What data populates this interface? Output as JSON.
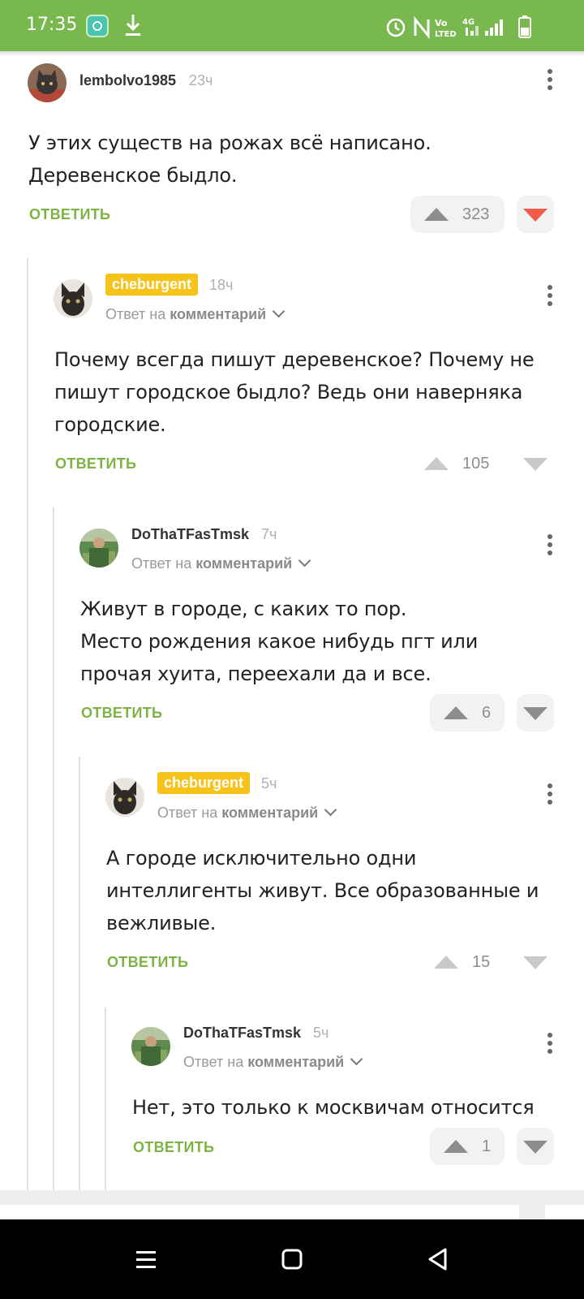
{
  "status_bar": {
    "time": "17:35",
    "icons": [
      "app-update-icon",
      "download-icon",
      "alarm-icon",
      "nfc-icon",
      "volte-icon",
      "4g-signal-icon",
      "signal-icon",
      "battery-icon"
    ]
  },
  "comments": [
    {
      "username": "lembolvo1985",
      "badge": false,
      "time": "23ч",
      "reply_prefix": "",
      "reply_target": "",
      "text": [
        "У этих существ на рожах всё написано.",
        "Деревенское быдло."
      ],
      "reply_label": "ОТВЕТИТЬ",
      "score": "323",
      "downvoted": true
    },
    {
      "username": "cheburgent",
      "badge": true,
      "time": "18ч",
      "reply_prefix": "Ответ на",
      "reply_target": "комментарий",
      "text": [
        "Почему всегда пишут деревенское? Почему не",
        "пишут городское быдло? Ведь они наверняка",
        "городские."
      ],
      "reply_label": "ОТВЕТИТЬ",
      "score": "105",
      "downvoted": false
    },
    {
      "username": "DoThaTFasTmsk",
      "badge": false,
      "time": "7ч",
      "reply_prefix": "Ответ на",
      "reply_target": "комментарий",
      "text": [
        "Живут в городе, с каких то пор.",
        "Место рождения какое нибудь пгт или",
        "прочая хуита, переехали да и все."
      ],
      "reply_label": "ОТВЕТИТЬ",
      "score": "6",
      "downvoted": false
    },
    {
      "username": "cheburgent",
      "badge": true,
      "time": "5ч",
      "reply_prefix": "Ответ на",
      "reply_target": "комментарий",
      "text": [
        "А городе исключительно одни",
        "интеллигенты живут. Все образованные и",
        "вежливые."
      ],
      "reply_label": "ОТВЕТИТЬ",
      "score": "15",
      "downvoted": false
    },
    {
      "username": "DoThaTFasTmsk",
      "badge": false,
      "time": "5ч",
      "reply_prefix": "Ответ на",
      "reply_target": "комментарий",
      "text": [
        "Нет, это только к москвичам относится"
      ],
      "reply_label": "ОТВЕТИТЬ",
      "score": "1",
      "downvoted": false
    }
  ],
  "colors": {
    "status_bar": "#79b84f",
    "reply_link": "#7cb342",
    "badge": "#f7c31a",
    "downvote_active": "#f35b4b"
  },
  "navigation": [
    "menu-icon",
    "home-icon",
    "back-icon"
  ]
}
